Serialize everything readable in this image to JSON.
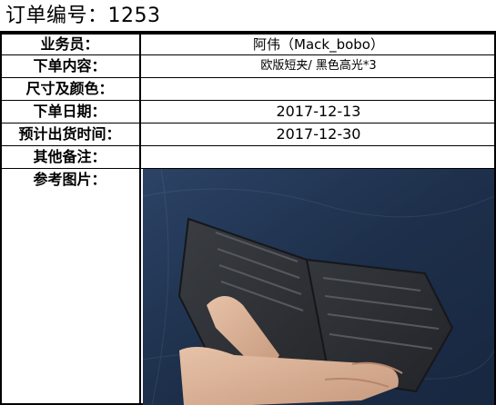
{
  "order": {
    "title": "订单编号：1253"
  },
  "fields": [
    {
      "label": "业务员：",
      "value": "阿伟（Mack_bobo）"
    },
    {
      "label": "下单内容：",
      "value": "欧版短夹/ 黑色高光*3"
    },
    {
      "label": "尺寸及颜色：",
      "value": ""
    },
    {
      "label": "下单日期：",
      "value": "2017-12-13"
    },
    {
      "label": "预计出货时间：",
      "value": "2017-12-30"
    },
    {
      "label": "其他备注：",
      "value": ""
    },
    {
      "label": "参考图片：",
      "value": ""
    }
  ],
  "photo": {
    "icon": "wallet-photo",
    "colors": {
      "background": "#1d2f4a",
      "leather": "#2b2e33",
      "skin": "#d9b39a"
    }
  }
}
